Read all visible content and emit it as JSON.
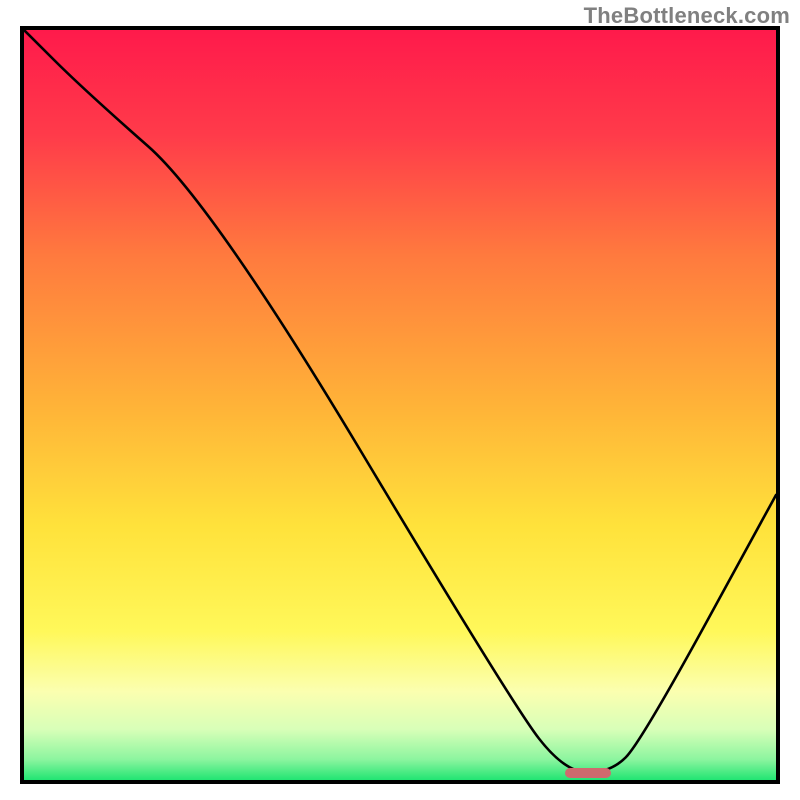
{
  "watermark": "TheBottleneck.com",
  "chart_data": {
    "type": "line",
    "title": "",
    "xlabel": "",
    "ylabel": "",
    "xlim": [
      0,
      100
    ],
    "ylim": [
      0,
      100
    ],
    "grid": false,
    "legend": false,
    "series": [
      {
        "name": "bottleneck-curve",
        "x": [
          0,
          8,
          25,
          65,
          72,
          78,
          82,
          100
        ],
        "values": [
          100,
          92,
          77,
          10,
          1,
          1,
          5,
          38
        ]
      }
    ],
    "marker": {
      "x_center": 75,
      "width_pct": 6,
      "y": 0.5
    },
    "gradient_stops": [
      {
        "pct": 0,
        "color": "#ff1a4b"
      },
      {
        "pct": 14,
        "color": "#ff3b4a"
      },
      {
        "pct": 30,
        "color": "#ff7a3e"
      },
      {
        "pct": 50,
        "color": "#ffb338"
      },
      {
        "pct": 66,
        "color": "#ffe23b"
      },
      {
        "pct": 80,
        "color": "#fff85a"
      },
      {
        "pct": 88,
        "color": "#fbffb0"
      },
      {
        "pct": 93,
        "color": "#d8ffb8"
      },
      {
        "pct": 97,
        "color": "#8cf59f"
      },
      {
        "pct": 100,
        "color": "#17e36e"
      }
    ]
  }
}
